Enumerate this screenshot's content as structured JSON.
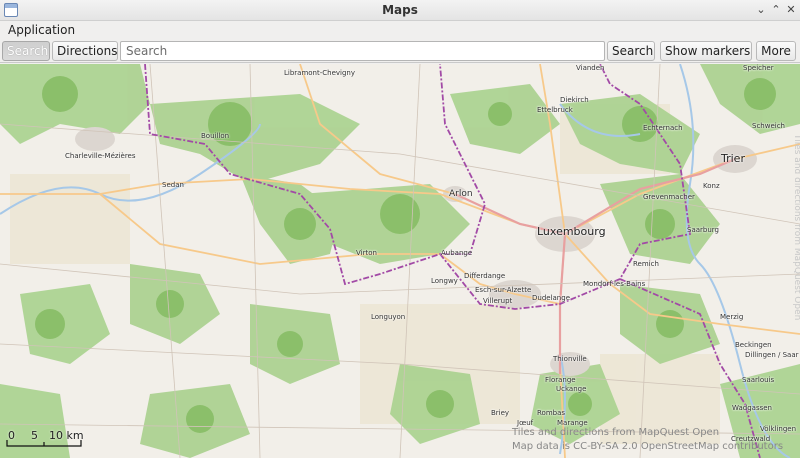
{
  "window": {
    "title": "Maps"
  },
  "menubar": {
    "application": "Application"
  },
  "toolbar": {
    "search_tab": "Search",
    "directions_tab": "Directions",
    "search_placeholder": "Search",
    "search_button": "Search",
    "show_markers_button": "Show markers",
    "more_button": "More"
  },
  "map": {
    "places": [
      "Vianden",
      "Speicher",
      "Libramont-Chevigny",
      "Diekirch",
      "Ettelbruck",
      "Bouillon",
      "Echternach",
      "Schweich",
      "Charleville-Mézières",
      "Trier",
      "Sedan",
      "Arlon",
      "Grevenmacher",
      "Konz",
      "Luxembourg",
      "Saarburg",
      "Virton",
      "Aubange",
      "Differdange",
      "Remich",
      "Longwy",
      "Esch-sur-Alzette",
      "Mondorf-les-Bains",
      "Villerupt",
      "Dudelange",
      "Longuyon",
      "Merzig",
      "Thionville",
      "Beckingen",
      "Dillingen / Saar",
      "Saarlouis",
      "Florange",
      "Uckange",
      "Wadgassen",
      "Briey",
      "Rombas",
      "Jœuf",
      "Marange",
      "Creutzwald",
      "Völklingen"
    ],
    "scale": {
      "zero": "0",
      "five": "5",
      "ten": "10 km"
    },
    "attribution_line1": "Tiles and directions from MapQuest Open",
    "attribution_line2": "Map data is CC-BY-SA 2.0 OpenStreetMap contributors",
    "side_watermark": "Tiles and directions from MapQuest Open"
  }
}
